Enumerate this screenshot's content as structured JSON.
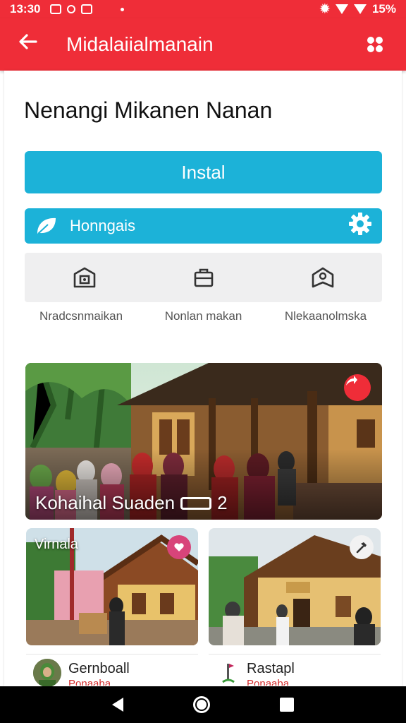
{
  "status": {
    "time": "13:30",
    "battery": "15%"
  },
  "app_bar": {
    "title": "Midalaiialmanain",
    "back_icon": "arrow-left-icon",
    "action_icon": "settings-icon"
  },
  "page": {
    "title": "Nenangi Mikanen Nanan"
  },
  "install": {
    "label": "Instal"
  },
  "category": {
    "label": "Honngais",
    "icon": "leaf-icon",
    "action_icon": "gear-icon"
  },
  "quick_actions": [
    {
      "label": "Nradcsnmaikan",
      "icon": "house-icon"
    },
    {
      "label": "Nonlan makan",
      "icon": "briefcase-icon"
    },
    {
      "label": "Nlekaanolmska",
      "icon": "location-home-icon"
    }
  ],
  "hero": {
    "caption": "Kohaihal Suaden",
    "count": "2",
    "badge_icon": "share-icon"
  },
  "cards": [
    {
      "label": "Virnala",
      "badge_icon": "heart-icon"
    },
    {
      "label": "",
      "badge_icon": "hammer-icon"
    }
  ],
  "mini_cards": [
    {
      "name": "Gernboall",
      "sub": "Ponaaba"
    },
    {
      "name": "Rastapl",
      "sub": "Ponaaba"
    }
  ],
  "colors": {
    "accent": "#ef2d38",
    "primary": "#1cb2d8"
  }
}
